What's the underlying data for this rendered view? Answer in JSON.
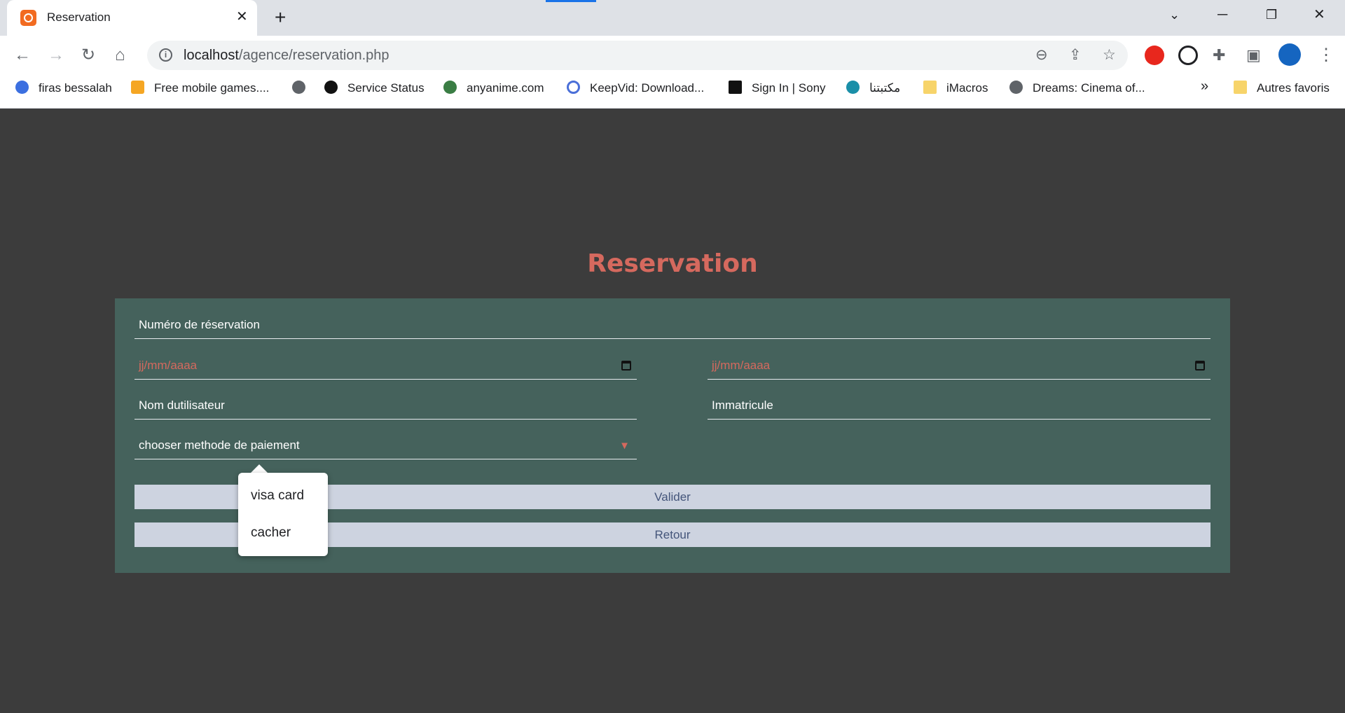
{
  "browser": {
    "tab_title": "Reservation",
    "url_host": "localhost",
    "url_path": "/agence/reservation.php",
    "bookmarks": [
      {
        "label": "firas bessalah"
      },
      {
        "label": "Free mobile games...."
      },
      {
        "label": ""
      },
      {
        "label": "Service Status"
      },
      {
        "label": "anyanime.com"
      },
      {
        "label": "KeepVid: Download..."
      },
      {
        "label": "Sign In | Sony"
      },
      {
        "label": "مكتبتنا"
      },
      {
        "label": "iMacros"
      },
      {
        "label": "Dreams: Cinema of..."
      }
    ],
    "other_bookmarks": "Autres favoris",
    "overflow_label": "»"
  },
  "page": {
    "title": "Reservation",
    "fields": {
      "reservation_number": "Numéro de réservation",
      "date_start_placeholder": "jj/mm/aaaa",
      "date_end_placeholder": "jj/mm/aaaa",
      "username": "Nom dutilisateur",
      "immatricule": "Immatricule",
      "payment_method": "chooser methode de paiement"
    },
    "dropdown_options": [
      "visa card",
      "cacher"
    ],
    "buttons": {
      "submit": "Valider",
      "back": "Retour"
    }
  },
  "colors": {
    "page_bg": "#3c3c3c",
    "form_bg": "#45625c",
    "title_color": "#d5695e",
    "button_bg": "#cdd3e0"
  }
}
